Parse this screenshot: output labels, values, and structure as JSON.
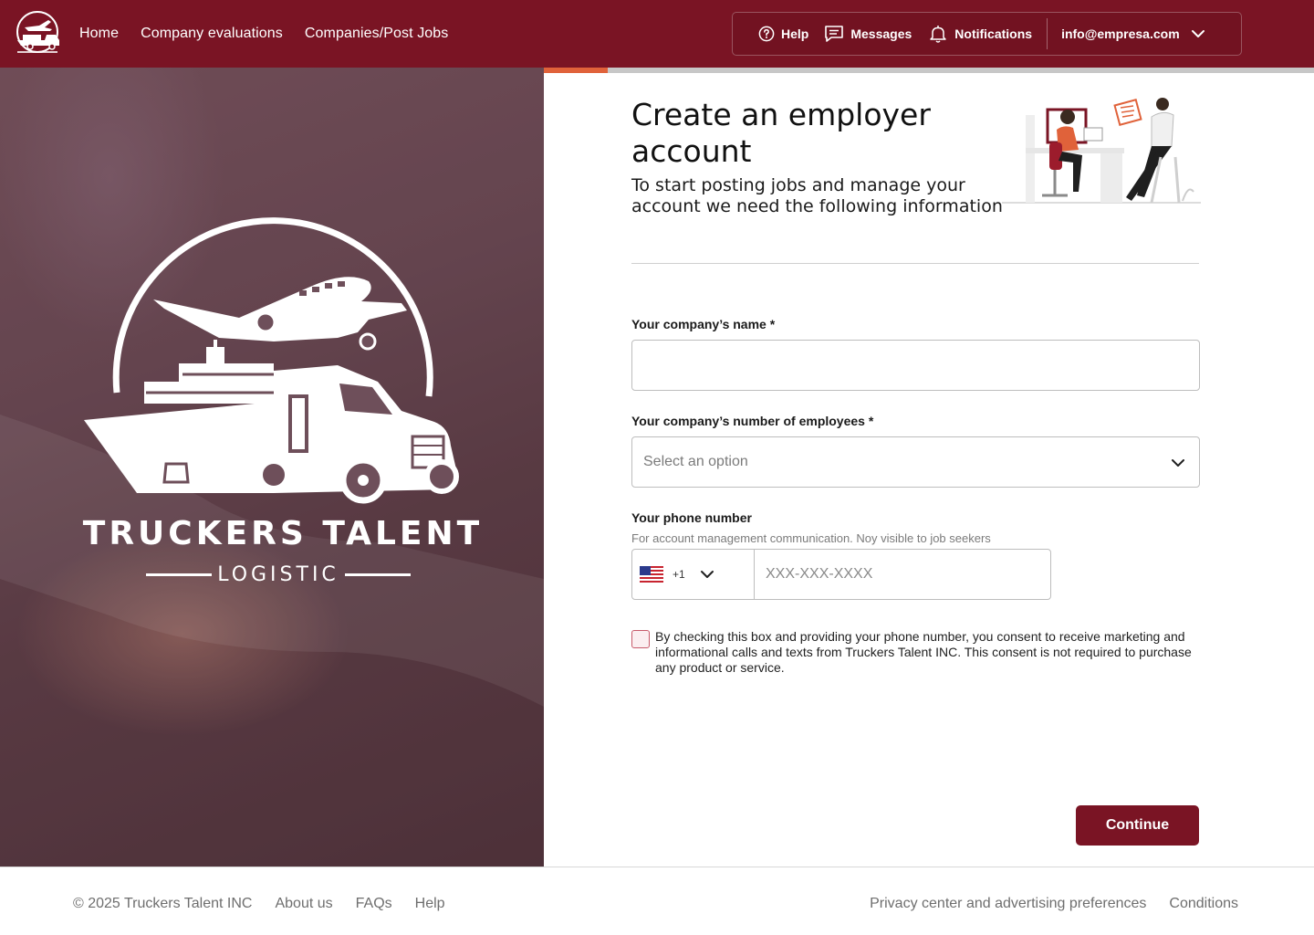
{
  "brand": {
    "name": "TRUCKERS TALENT",
    "tagline": "LOGISTIC",
    "primary_color": "#7a1424",
    "accent_color": "#e0623a"
  },
  "nav": {
    "items": [
      {
        "label": "Home"
      },
      {
        "label": "Company evaluations"
      },
      {
        "label": "Companies/Post Jobs"
      }
    ]
  },
  "account_bar": {
    "help_label": "Help",
    "messages_label": "Messages",
    "notifications_label": "Notifications",
    "email": "info@empresa.com"
  },
  "progress": {
    "fraction": 0.083
  },
  "form": {
    "title": "Create an employer account",
    "lead": "To start posting jobs and manage your account we need the following information",
    "company_name_label": "Your company’s name *",
    "company_name_value": "",
    "employees_label": "Your company’s number of employees *",
    "employees_placeholder": "Select an option",
    "phone_label": "Your phone number",
    "phone_hint": "For account management communication. Noy visible to job seekers",
    "country_code": "+1",
    "country_flag": "us-flag-icon",
    "phone_placeholder": "XXX-XXX-XXXX",
    "consent_text": "By checking this box and providing your phone number, you consent to receive marketing and informational calls and texts from Truckers Talent INC. This consent is not required to purchase any product or service.",
    "consent_checked": false,
    "continue_label": "Continue"
  },
  "footer": {
    "copyright": "© 2025 Truckers Talent INC",
    "left_links": [
      "About us",
      "FAQs",
      "Help"
    ],
    "right_links": [
      "Privacy center and advertising preferences",
      "Conditions"
    ]
  }
}
